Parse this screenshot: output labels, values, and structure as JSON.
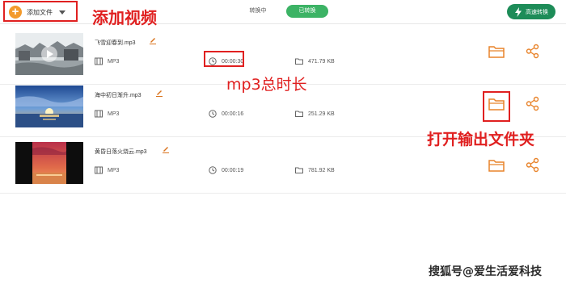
{
  "toolbar": {
    "add_file_label": "添加文件",
    "tab_converting": "转换中",
    "tab_converted": "已转换",
    "fast_convert": "高速转换"
  },
  "files": [
    {
      "name": "飞雪迎春到.mp3",
      "format": "MP3",
      "duration": "00:00:30",
      "size": "471.79 KB"
    },
    {
      "name": "海中初日渐升.mp3",
      "format": "MP3",
      "duration": "00:00:16",
      "size": "251.29 KB"
    },
    {
      "name": "黄昏日落火烧云.mp3",
      "format": "MP3",
      "duration": "00:00:19",
      "size": "781.92 KB"
    }
  ],
  "annotations": {
    "add_video": "添加视频",
    "mp3_duration": "mp3总时长",
    "open_output_folder": "打开输出文件夹"
  },
  "watermark": "搜狐号@爱生活爱科技",
  "colors": {
    "accent_orange": "#f39a2c",
    "converted_tab": "#3cb365",
    "fast_button": "#1d8c58",
    "annotation_red": "#e02020"
  }
}
